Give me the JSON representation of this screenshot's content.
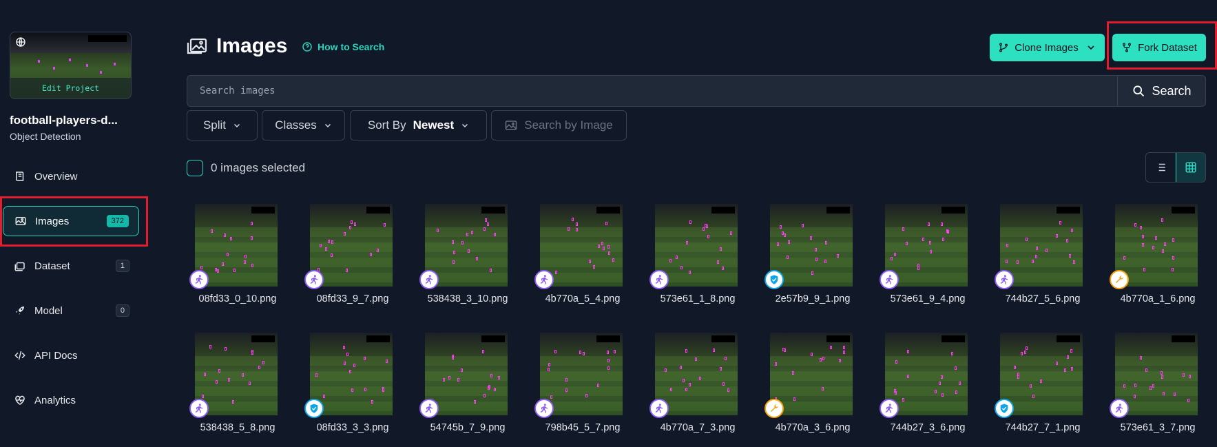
{
  "project": {
    "thumbnail_label": "Edit Project",
    "name": "football-players-d...",
    "type": "Object Detection"
  },
  "sidebar": {
    "items": [
      {
        "label": "Overview",
        "icon": "book-icon",
        "count": ""
      },
      {
        "label": "Images",
        "icon": "images-icon",
        "count": "372",
        "active": true
      },
      {
        "label": "Dataset",
        "icon": "layers-icon",
        "count": "1"
      },
      {
        "label": "Model",
        "icon": "rocket-icon",
        "count": "0"
      },
      {
        "label": "API Docs",
        "icon": "code-icon",
        "count": ""
      },
      {
        "label": "Analytics",
        "icon": "heart-pulse-icon",
        "count": ""
      }
    ]
  },
  "header": {
    "title": "Images",
    "how_to_search": "How to Search",
    "clone_label": "Clone Images",
    "fork_label": "Fork Dataset"
  },
  "search": {
    "placeholder": "Search images",
    "button_label": "Search"
  },
  "filters": {
    "split": "Split",
    "classes": "Classes",
    "sort_by": "Sort By",
    "sort_value": "Newest",
    "search_by_image": "Search by Image"
  },
  "selection": {
    "text": "0 images selected"
  },
  "colors": {
    "accent": "#2ce0c0",
    "background": "#111827",
    "highlight": "#e11d2e",
    "annotation": "#ff3bf5"
  },
  "images": [
    {
      "name": "08fd33_0_10.png",
      "badge": "runner-icon"
    },
    {
      "name": "08fd33_9_7.png",
      "badge": "runner-icon"
    },
    {
      "name": "538438_3_10.png",
      "badge": "runner-icon"
    },
    {
      "name": "4b770a_5_4.png",
      "badge": "runner-icon"
    },
    {
      "name": "573e61_1_8.png",
      "badge": "runner-icon"
    },
    {
      "name": "2e57b9_9_1.png",
      "badge": "shield-icon"
    },
    {
      "name": "573e61_9_4.png",
      "badge": "runner-icon"
    },
    {
      "name": "744b27_5_6.png",
      "badge": "runner-icon"
    },
    {
      "name": "4b770a_1_6.png",
      "badge": "wrench-icon"
    },
    {
      "name": "538438_5_8.png",
      "badge": "runner-icon"
    },
    {
      "name": "08fd33_3_3.png",
      "badge": "shield-icon"
    },
    {
      "name": "54745b_7_9.png",
      "badge": "runner-icon"
    },
    {
      "name": "798b45_5_7.png",
      "badge": "runner-icon"
    },
    {
      "name": "4b770a_7_3.png",
      "badge": "runner-icon"
    },
    {
      "name": "4b770a_3_6.png",
      "badge": "wrench-icon"
    },
    {
      "name": "744b27_3_6.png",
      "badge": "runner-icon"
    },
    {
      "name": "744b27_7_1.png",
      "badge": "shield-icon"
    },
    {
      "name": "573e61_3_7.png",
      "badge": "runner-icon"
    }
  ]
}
